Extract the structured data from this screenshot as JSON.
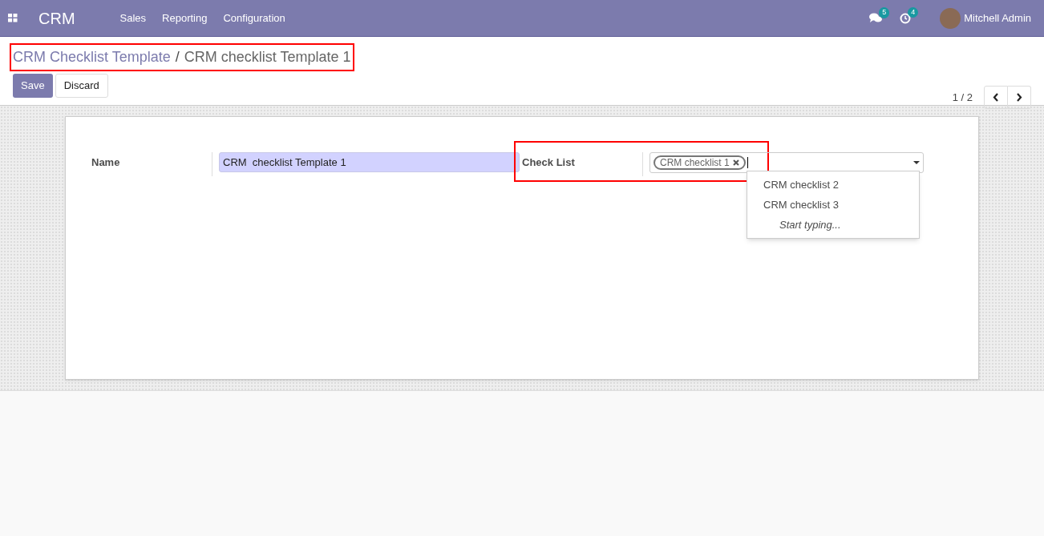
{
  "navbar": {
    "app_name": "CRM",
    "menu": [
      "Sales",
      "Reporting",
      "Configuration"
    ],
    "messages_count": "5",
    "activities_count": "4",
    "user_name": "Mitchell Admin"
  },
  "breadcrumb": {
    "parent": "CRM Checklist Template",
    "separator": "/",
    "current": "CRM checklist Template 1",
    "highlighted": true
  },
  "buttons": {
    "save": "Save",
    "discard": "Discard"
  },
  "pager": {
    "value": "1 / 2"
  },
  "form": {
    "name_label": "Name",
    "name_value": "CRM  checklist Template 1",
    "checklist_label": "Check List",
    "checklist_highlighted": true,
    "tags": [
      "CRM checklist 1"
    ],
    "dropdown": {
      "options": [
        "CRM checklist 2",
        "CRM checklist 3"
      ],
      "hint": "Start typing..."
    }
  }
}
